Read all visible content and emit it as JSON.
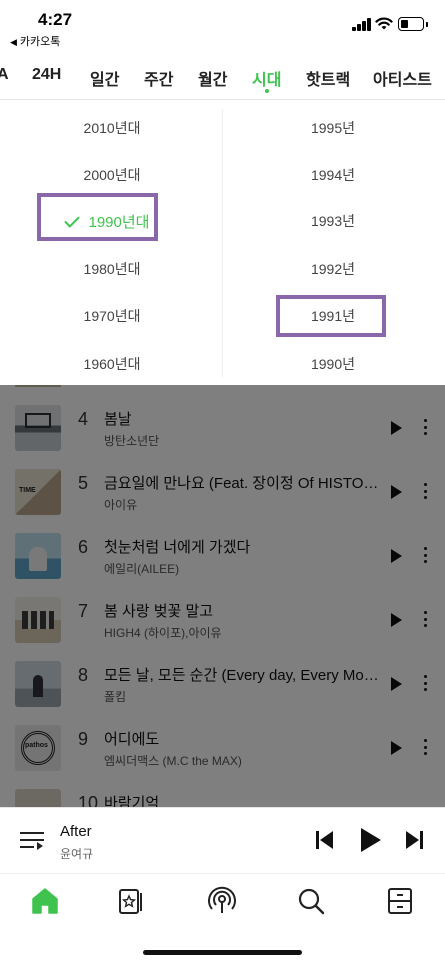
{
  "status_bar": {
    "time": "4:27",
    "back_app": "카카오톡"
  },
  "tabs": [
    {
      "label": "A",
      "active": false
    },
    {
      "label": "24H",
      "active": false
    },
    {
      "label": "일간",
      "active": false
    },
    {
      "label": "주간",
      "active": false
    },
    {
      "label": "월간",
      "active": false
    },
    {
      "label": "시대",
      "active": true
    },
    {
      "label": "핫트랙",
      "active": false
    },
    {
      "label": "아티스트",
      "active": false
    }
  ],
  "picker": {
    "decades": [
      "2010년대",
      "2000년대",
      "1990년대",
      "1980년대",
      "1970년대",
      "1960년대"
    ],
    "selected_decade": "1990년대",
    "years": [
      "1995년",
      "1994년",
      "1993년",
      "1992년",
      "1991년",
      "1990년"
    ],
    "highlighted_year": "1991년"
  },
  "chart": [
    {
      "rank": "4",
      "title": "봄날",
      "artist": "방탄소년단"
    },
    {
      "rank": "5",
      "title": "금요일에 만나요 (Feat. 장이정 Of HISTORY)",
      "artist": "아이유"
    },
    {
      "rank": "6",
      "title": "첫눈처럼 너에게 가겠다",
      "artist": "에일리(AILEE)"
    },
    {
      "rank": "7",
      "title": "봄 사랑 벚꽃 말고",
      "artist": "HIGH4 (하이포),아이유"
    },
    {
      "rank": "8",
      "title": "모든 날, 모든 순간 (Every day, Every Moment)",
      "artist": "폴킴"
    },
    {
      "rank": "9",
      "title": "어디에도",
      "artist": "엠씨더맥스 (M.C the MAX)"
    },
    {
      "rank": "10",
      "title": "바람기억",
      "artist": ""
    }
  ],
  "album_art_text": {
    "row5": "TIME",
    "row9": "pathos"
  },
  "player": {
    "title": "After",
    "artist": "윤여규"
  },
  "colors": {
    "accent": "#3fc34e",
    "highlight_border": "#8967a8"
  },
  "nav_icons": [
    "home-icon",
    "library-icon",
    "podcast-icon",
    "search-icon",
    "drawer-icon"
  ]
}
